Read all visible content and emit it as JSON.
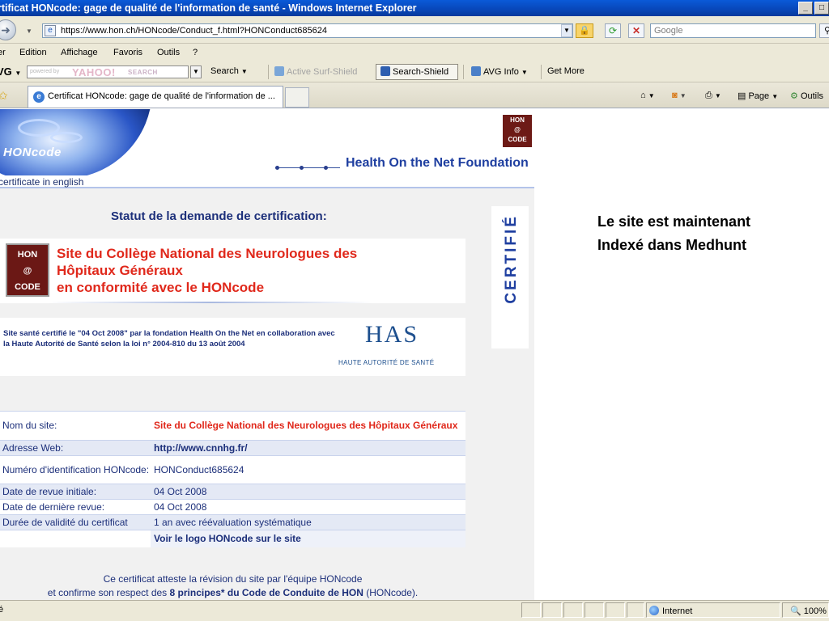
{
  "window": {
    "title": "rtificat HONcode: gage de qualité de l'information de santé - Windows Internet Explorer"
  },
  "address_bar": {
    "url": "https://www.hon.ch/HONcode/Conduct_f.html?HONConduct685624",
    "search_placeholder": "Google"
  },
  "menu": [
    "er",
    "Edition",
    "Affichage",
    "Favoris",
    "Outils",
    "?"
  ],
  "avg_toolbar": {
    "logo": "VG",
    "yahoo_powered": "powered by",
    "yahoo_brand": "YAHOO!",
    "yahoo_search": "SEARCH",
    "search_label": "Search",
    "active_surf_shield": "Active Surf-Shield",
    "search_shield": "Search-Shield",
    "avg_info": "AVG Info",
    "get_more": "Get More"
  },
  "tabs": [
    {
      "label": "Certificat HONcode: gage de qualité de l'information de ..."
    }
  ],
  "command_bar": {
    "page": "Page",
    "outils": "Outils"
  },
  "page": {
    "banner": {
      "honcode_brand": "HONcode",
      "foundation": "Health On the Net Foundation",
      "badge_lines": [
        "HON",
        "@",
        "CODE"
      ]
    },
    "certificate_in_english": "certificate in english",
    "statut_title": "Statut de la demande de certification:",
    "site_logo_lines": [
      "HON",
      "@",
      "CODE"
    ],
    "site_title_lines": [
      "Site du Collège National des Neurologues des",
      "Hôpitaux Généraux",
      "en conformité avec le HONcode"
    ],
    "has_text": "Site santé certifié le \"04 Oct 2008\" par la fondation Health On the Net en collaboration avec la Haute Autorité de Santé selon la loi n° 2004-810 du 13 août 2004",
    "has_logo": "HAS",
    "has_subtitle": "HAUTE AUTORITÉ DE SANTÉ",
    "certifie": "CERTIFIÉ",
    "info_table": [
      {
        "label": "Nom du site:",
        "value": "Site du Collège National des Neurologues des Hôpitaux Généraux"
      },
      {
        "label": "Adresse Web:",
        "value": "http://www.cnnhg.fr/"
      },
      {
        "label": "Numéro d'identification HONcode:",
        "value": "HONConduct685624"
      },
      {
        "label": "Date de revue initiale:",
        "value": "04 Oct 2008"
      },
      {
        "label": "Date de dernière revue:",
        "value": "04 Oct 2008"
      },
      {
        "label": "Durée de validité du certificat",
        "value": "1 an avec réévaluation systématique"
      },
      {
        "label": "",
        "value": "Voir le logo HONcode sur le site"
      }
    ],
    "attest": {
      "line1": "Ce certificat atteste la révision du site par l'équipe HONcode",
      "line2_pre": "et confirme son respect des ",
      "line2_bold": "8 principes* du Code de Conduite de HON",
      "line2_post": " (HONcode)."
    }
  },
  "side_note": {
    "line1": "Le site est maintenant",
    "line2": "Indexé dans Medhunt"
  },
  "status_bar": {
    "left": "é",
    "zone": "Internet",
    "zoom": "100%"
  }
}
